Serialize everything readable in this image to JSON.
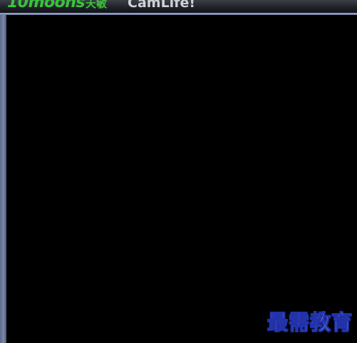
{
  "titlebar": {
    "brand_latin": "10moons",
    "brand_cjk": "天敏",
    "app_name": "CamLife!"
  },
  "watermark": {
    "text": "最需教育"
  },
  "colors": {
    "brand_green": "#39c43a",
    "app_name_gray": "#cfd1d4",
    "rail_blue": "#6f7fa6",
    "video_background": "#000000",
    "watermark_outline": "#2233aa"
  }
}
